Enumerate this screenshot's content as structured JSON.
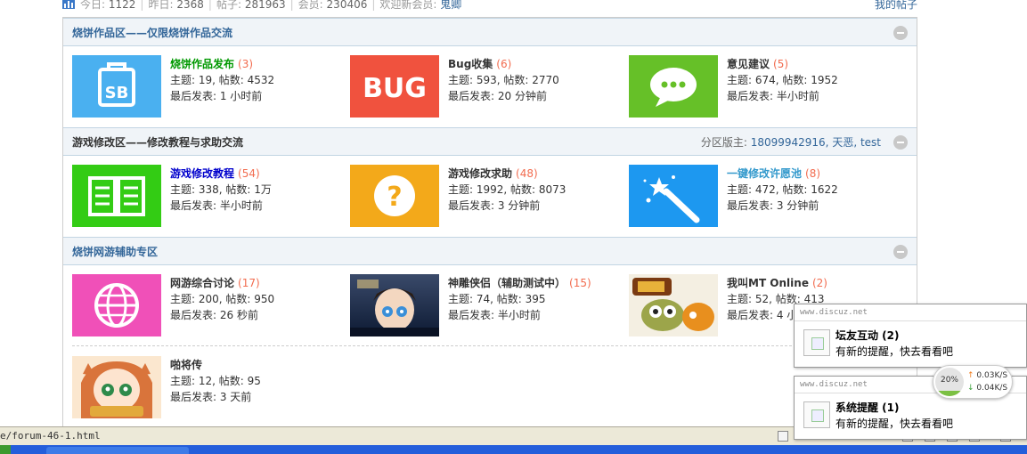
{
  "stats": {
    "today_label": "今日:",
    "today": "1122",
    "yesterday_label": "昨日:",
    "yesterday": "2368",
    "posts_label": "帖子:",
    "posts": "281963",
    "members_label": "会员:",
    "members": "230406",
    "welcome_label": "欢迎新会员:",
    "new_member": "鬼卿",
    "my_threads": "我的帖子"
  },
  "categories": [
    {
      "title": "烧饼作品区——仅限烧饼作品交流",
      "forums": [
        {
          "name": "烧饼作品发布",
          "count": "(3)",
          "stats": "主题: 19, 帖数: 4532",
          "last": "最后发表: 1 小时前",
          "icon": "sb-bag-icon",
          "color": "#4ab0f0"
        },
        {
          "name": "Bug收集",
          "count": "(6)",
          "stats": "主题: 593, 帖数: 2770",
          "last": "最后发表: 20 分钟前",
          "icon": "bug-text-icon",
          "color": "#f0523e"
        },
        {
          "name": "意见建议",
          "count": "(5)",
          "stats": "主题: 674, 帖数: 1952",
          "last": "最后发表: 半小时前",
          "icon": "chat-bubble-icon",
          "color": "#66c028"
        }
      ]
    },
    {
      "title": "游戏修改区——修改教程与求助交流",
      "moderators_label": "分区版主:",
      "moderators": "18099942916, 天恶, test",
      "forums": [
        {
          "name": "游戏修改教程",
          "count": "(54)",
          "stats": "主题: 338, 帖数: 1万",
          "last": "最后发表: 半小时前",
          "icon": "open-book-icon",
          "color": "#33cc14"
        },
        {
          "name": "游戏修改求助",
          "count": "(48)",
          "stats": "主题: 1992, 帖数: 8073",
          "last": "最后发表: 3 分钟前",
          "icon": "question-mark-icon",
          "color": "#f3a91a"
        },
        {
          "name": "一键修改许愿池",
          "count": "(8)",
          "stats": "主题: 472, 帖数: 1622",
          "last": "最后发表: 3 分钟前",
          "icon": "magic-wand-icon",
          "color": "#1d98f0"
        }
      ]
    },
    {
      "title": "烧饼网游辅助专区",
      "forums": [
        {
          "name": "网游综合讨论",
          "count": "(17)",
          "stats": "主题: 200, 帖数: 950",
          "last": "最后发表: 26 秒前",
          "icon": "globe-icon",
          "color": "#f050b8"
        },
        {
          "name": "神雕侠侣（辅助测试中）",
          "count": "(15)",
          "stats": "主题: 74, 帖数: 395",
          "last": "最后发表: 半小时前",
          "icon": "game-art-icon",
          "color": "#1d3a66"
        },
        {
          "name": "我叫MT Online",
          "count": "(2)",
          "stats": "主题: 52, 帖数: 413",
          "last": "最后发表: 4 小",
          "icon": "game-art-icon",
          "color": "#8a6a2a"
        },
        {
          "name": "啪将传",
          "count": "",
          "stats": "主题: 12, 帖数: 95",
          "last": "最后发表: 3 天前",
          "icon": "game-art-icon",
          "color": "#e79a55"
        }
      ]
    }
  ],
  "statusbar": {
    "url": "e/forum-46-1.html"
  },
  "popups": [
    {
      "site": "www.discuz.net",
      "title": "坛友互动 (2)",
      "message": "有新的提醒，快去看看吧"
    },
    {
      "site": "www.discuz.net",
      "title": "系统提醒 (1)",
      "message": "有新的提醒，快去看看吧"
    }
  ],
  "net_widget": {
    "percent": "20%",
    "percent_value": 0.2,
    "up": "0.03K/S",
    "down": "0.04K/S",
    "up_arrow": "↑",
    "down_arrow": "↓"
  }
}
